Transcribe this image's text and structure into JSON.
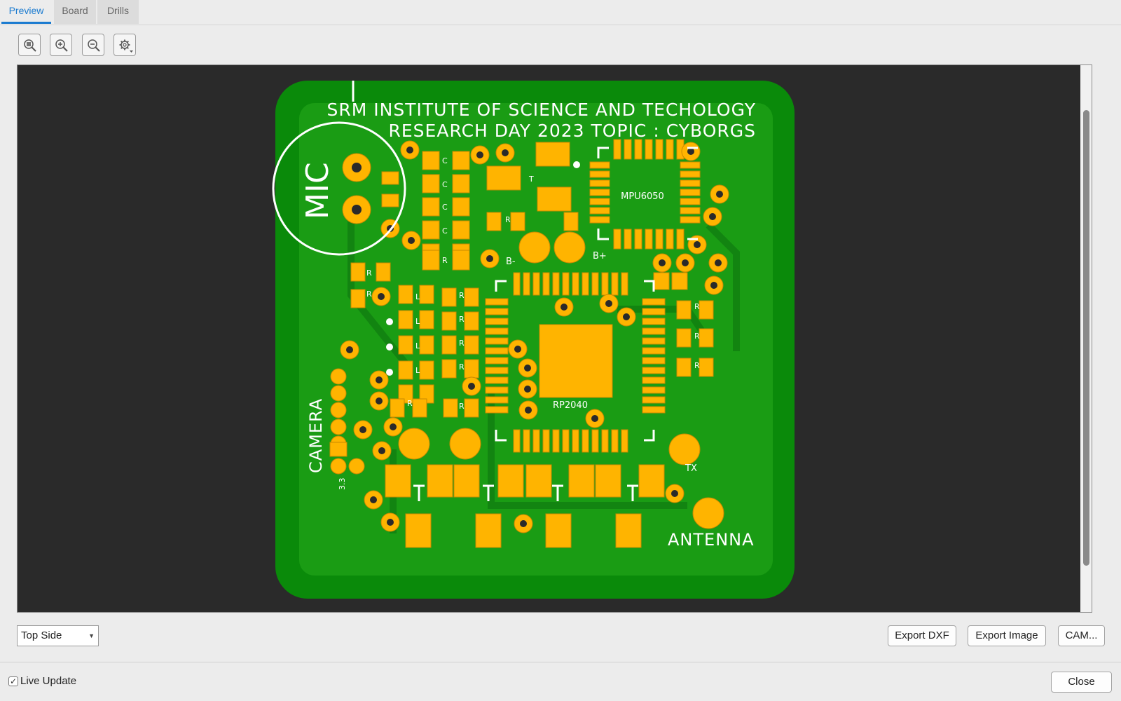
{
  "tabs": [
    {
      "label": "Preview",
      "active": true
    },
    {
      "label": "Board",
      "active": false
    },
    {
      "label": "Drills",
      "active": false
    }
  ],
  "toolbar": {
    "zoom_fit_icon": "zoom-fit-icon",
    "zoom_in_icon": "zoom-in-icon",
    "zoom_out_icon": "zoom-out-icon",
    "settings_icon": "gear-icon"
  },
  "board": {
    "title_line1": "SRM INSTITUTE OF SCIENCE AND TECHOLOGY",
    "title_line2": "RESEARCH DAY 2023 TOPIC : CYBORGS",
    "labels": {
      "mic": "MIC",
      "camera": "CAMERA",
      "antenna": "ANTENNA",
      "mpu": "MPU6050",
      "rp2040": "RP2040",
      "b_plus": "B+",
      "b_minus": "B-",
      "tx": "TX",
      "v33": "3.3",
      "t": "T",
      "r": "R",
      "l": "L",
      "c": "C"
    },
    "colors": {
      "substrate": "#0a8a0a",
      "copper_fill": "#1a9c14",
      "pad": "#ffb400",
      "pad_outline": "#c98a00",
      "hole": "#2a2a2a",
      "silkscreen": "#ffffff",
      "background": "#2a2a2a"
    }
  },
  "view_select": {
    "value": "Top Side"
  },
  "buttons": {
    "export_dxf": "Export DXF",
    "export_image": "Export Image",
    "cam": "CAM...",
    "close": "Close"
  },
  "live_update": {
    "label": "Live Update",
    "checked": true,
    "check_glyph": "✓"
  }
}
